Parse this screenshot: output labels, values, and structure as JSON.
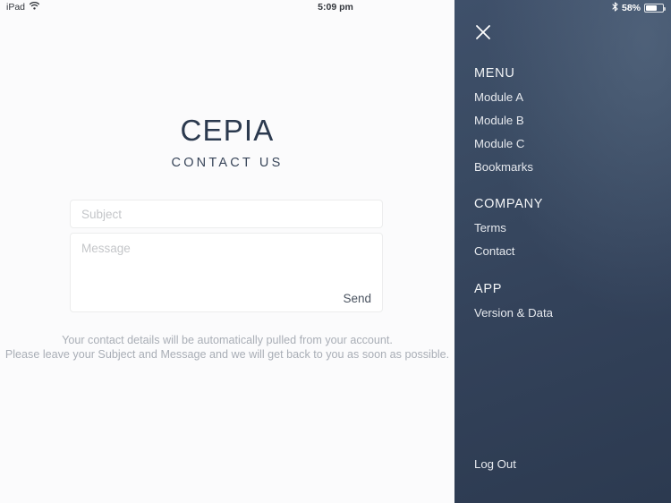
{
  "status_bar": {
    "device_label": "iPad",
    "wifi_icon": "wifi-icon",
    "time": "5:09 pm",
    "bluetooth_icon": "bluetooth-icon",
    "battery_percent": "58%",
    "battery_level": 58
  },
  "main": {
    "app_title": "CEPIA",
    "page_subtitle": "CONTACT US",
    "form": {
      "subject_placeholder": "Subject",
      "subject_value": "",
      "message_placeholder": "Message",
      "message_value": "",
      "send_label": "Send"
    },
    "helper_line1": "Your contact details will be automatically pulled from your account.",
    "helper_line2": "Please leave your Subject and Message and we will get back to you as soon as possible."
  },
  "sidebar": {
    "close_icon": "close-icon",
    "sections": [
      {
        "header": "MENU",
        "items": [
          {
            "label": "Module A"
          },
          {
            "label": "Module B"
          },
          {
            "label": "Module C"
          },
          {
            "label": "Bookmarks"
          }
        ]
      },
      {
        "header": "COMPANY",
        "items": [
          {
            "label": "Terms"
          },
          {
            "label": "Contact"
          }
        ]
      },
      {
        "header": "APP",
        "items": [
          {
            "label": "Version & Data"
          }
        ]
      }
    ],
    "logout_label": "Log Out"
  },
  "colors": {
    "title_navy": "#2c3a4f",
    "sidebar_top": "#3f506a",
    "sidebar_bottom": "#2c3a50",
    "content_background": "#fbfbfc",
    "placeholder_gray": "#c4c6c9",
    "helper_gray": "#a9aeb6"
  }
}
